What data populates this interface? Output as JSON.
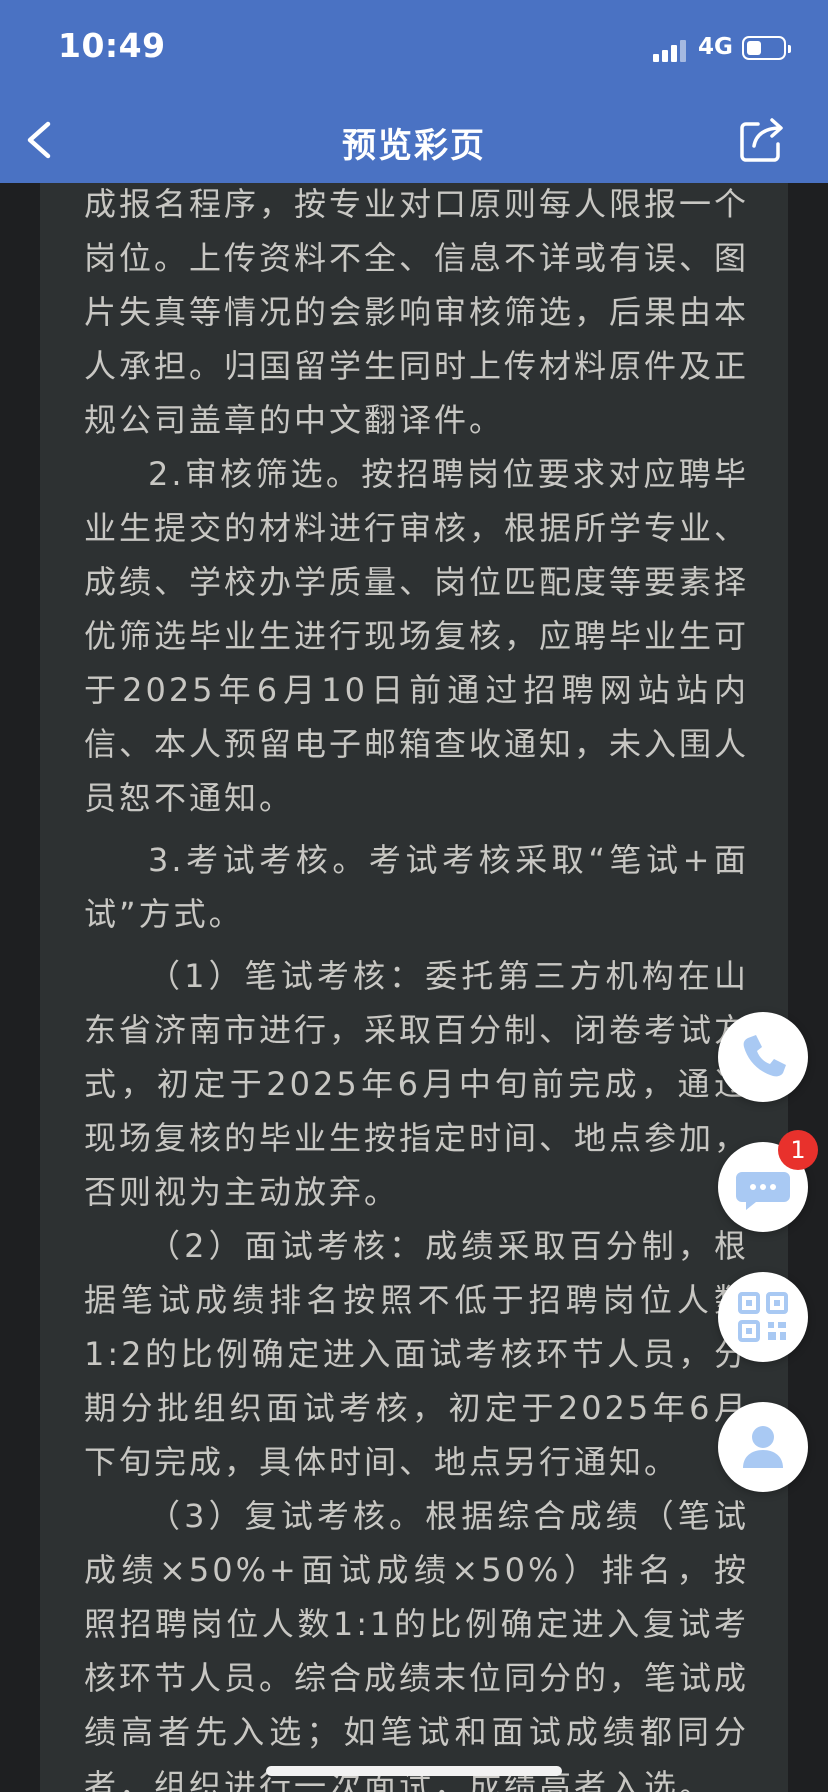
{
  "status_bar": {
    "time": "10:49",
    "network": "4G"
  },
  "nav": {
    "title": "预览彩页",
    "back_icon": "chevron-left-icon",
    "share_icon": "share-icon"
  },
  "document": {
    "paragraphs": [
      "成报名程序，按专业对口原则每人限报一个岗位。上传资料不全、信息不详或有误、图片失真等情况的会影响审核筛选，后果由本人承担。归国留学生同时上传材料原件及正规公司盖章的中文翻译件。",
      "2.审核筛选。按招聘岗位要求对应聘毕业生提交的材料进行审核，根据所学专业、成绩、学校办学质量、岗位匹配度等要素择优筛选毕业生进行现场复核，应聘毕业生可于2025年6月10日前通过招聘网站站内信、本人预留电子邮箱查收通知，未入围人员恕不通知。",
      "3.考试考核。考试考核采取“笔试+面试”方式。",
      "（1）笔试考核：委托第三方机构在山东省济南市进行，采取百分制、闭卷考试方式，初定于2025年6月中旬前完成，通过现场复核的毕业生按指定时间、地点参加，否则视为主动放弃。",
      "（2）面试考核：成绩采取百分制，根据笔试成绩排名按照不低于招聘岗位人数1:2的比例确定进入面试考核环节人员，分期分批组织面试考核，初定于2025年6月下旬完成，具体时间、地点另行通知。",
      "（3）复试考核。根据综合成绩（笔试成绩×50%+面试成绩×50%）排名，按照招聘岗位人数1:1的比例确定进入复试考核环节人员。综合成绩末位同分的，笔试成绩高者先入选；如笔试和面试成绩都同分者，组织进行一次面试，成绩高者入选。"
    ]
  },
  "floating_actions": {
    "phone_icon": "phone-icon",
    "chat_icon": "chat-bubble-icon",
    "chat_badge": "1",
    "qr_icon": "qr-code-icon",
    "user_icon": "user-icon"
  },
  "colors": {
    "header": "#4a72c3",
    "panel": "#2d3132",
    "text": "#c8c7c3",
    "fab_icon": "#a9c9f3",
    "badge": "#e8312c"
  }
}
